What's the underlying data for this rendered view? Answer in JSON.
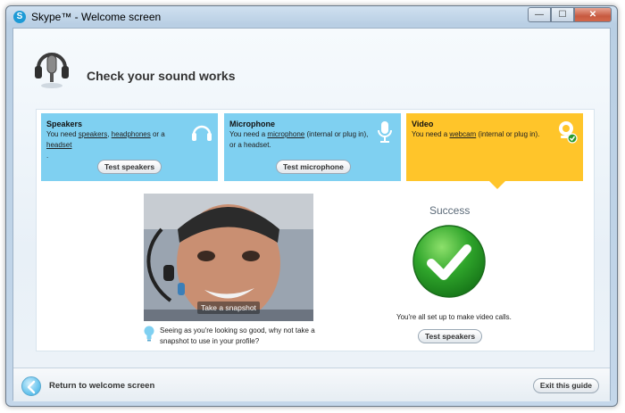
{
  "window": {
    "title": "Skype™ - Welcome screen",
    "app_icon": "S"
  },
  "window_controls": {
    "minimize": "—",
    "maximize": "☐",
    "close": "✕"
  },
  "header": {
    "title": "Check your sound works",
    "icon": "headset-microphone-icon"
  },
  "tabs": {
    "speakers": {
      "title": "Speakers",
      "desc_pre": "You need ",
      "link1": "speakers",
      "sep1": ", ",
      "link2": "headphones",
      "sep2": " or a ",
      "link3": "headset",
      "desc_post": ".",
      "button": "Test speakers",
      "icon": "headphones-icon",
      "color": "#7fd0f1"
    },
    "microphone": {
      "title": "Microphone",
      "desc_pre": "You need a ",
      "link1": "microphone",
      "desc_post": " (internal or plug in), or a headset.",
      "button": "Test microphone",
      "icon": "microphone-icon",
      "color": "#7fd0f1"
    },
    "video": {
      "title": "Video",
      "desc_pre": "You need a ",
      "link1": "webcam",
      "desc_post": " (internal or plug in).",
      "icon": "webcam-check-icon",
      "color": "#ffc52a"
    }
  },
  "preview": {
    "snapshot_label": "Take a snapshot",
    "tip": "Seeing as you're looking so good, why not take a snapshot to use in your profile?",
    "tip_icon": "lightbulb-icon"
  },
  "result": {
    "title": "Success",
    "message": "You're all set up to make video calls.",
    "button": "Test speakers",
    "icon": "success-check-icon"
  },
  "footer": {
    "back_label": "Return to welcome screen",
    "back_icon": "back-arrow-icon",
    "exit_button": "Exit this guide"
  }
}
